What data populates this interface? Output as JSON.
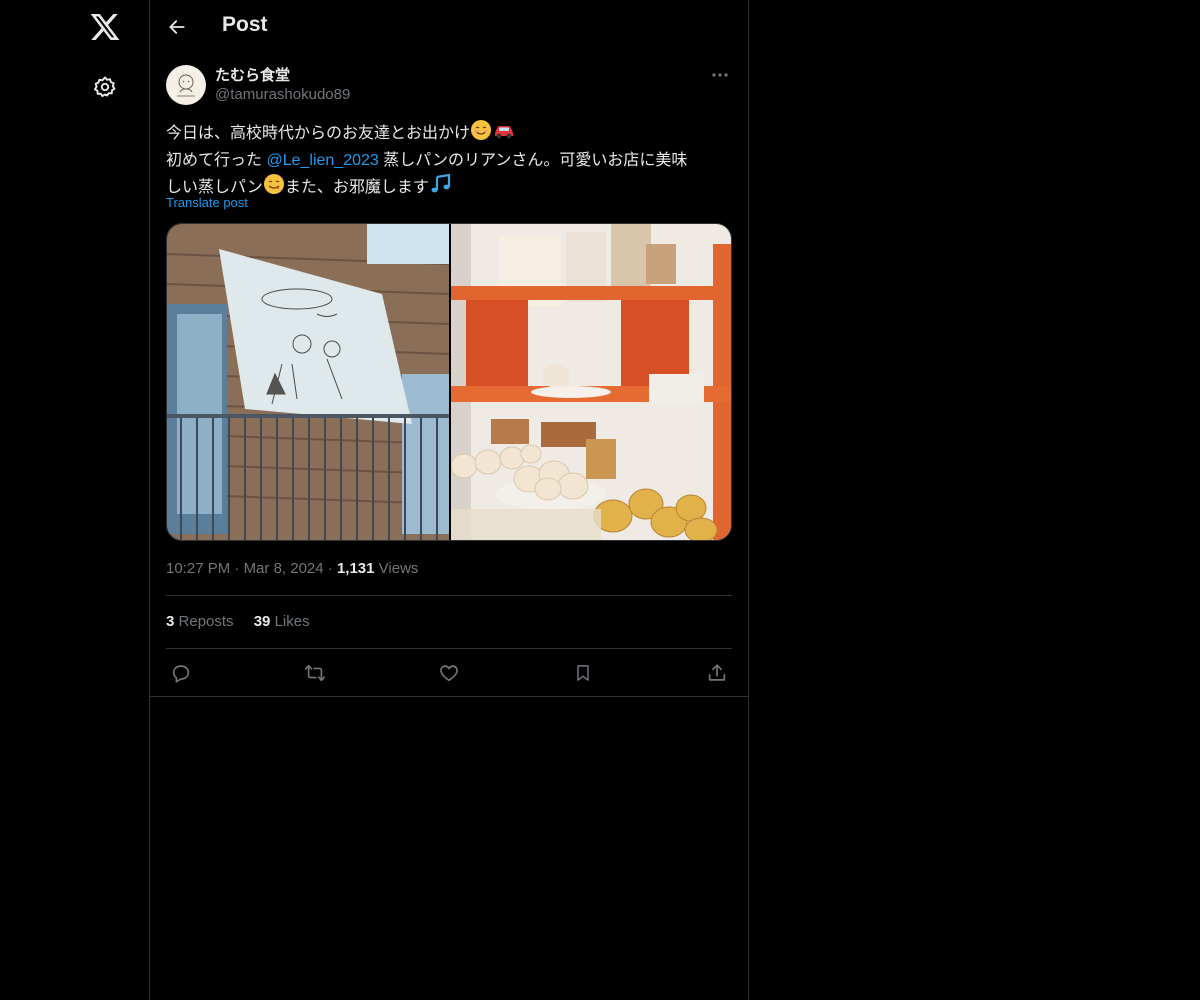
{
  "sidebar": {
    "logo_icon": "x-logo-icon",
    "settings_icon": "gear-icon"
  },
  "header": {
    "back_icon": "arrow-left-icon",
    "title": "Post"
  },
  "post": {
    "author": {
      "display_name": "たむら食堂",
      "handle": "@tamurashokudo89",
      "avatar_icon": "avatar-illustration"
    },
    "more_icon": "more-horizontal-icon",
    "text": {
      "line1": "今日は、高校時代からのお友達とお出かけ",
      "line1_emojis": [
        "smiling-face-emoji",
        "car-emoji"
      ],
      "line2_prefix": "初めて行った ",
      "mention": "@Le_lien_2023",
      "line2_suffix": " 蒸しパンのリアンさん。可愛いお店に美味",
      "line3_a": "しい蒸しパン",
      "line3_b": "また、お邪魔します",
      "line3_emojis": [
        "yum-face-emoji",
        "musical-notes-emoji"
      ]
    },
    "translate_label": "Translate post",
    "media": [
      {
        "name": "photo-shop-awning",
        "alt_icon": "photo"
      },
      {
        "name": "photo-bread-shelf",
        "alt_icon": "photo"
      }
    ],
    "meta": {
      "time": "10:27 PM",
      "separator": "·",
      "date": "Mar 8, 2024",
      "views_count": "1,131",
      "views_label": "Views"
    },
    "stats": {
      "reposts_count": "3",
      "reposts_label": "Reposts",
      "likes_count": "39",
      "likes_label": "Likes"
    },
    "actions": [
      "reply-icon",
      "repost-icon",
      "like-icon",
      "bookmark-icon",
      "share-icon"
    ]
  },
  "colors": {
    "background": "#000000",
    "text": "#e7e9ea",
    "secondary_text": "#71767b",
    "link": "#1d9bf0",
    "border": "#2f3336"
  }
}
